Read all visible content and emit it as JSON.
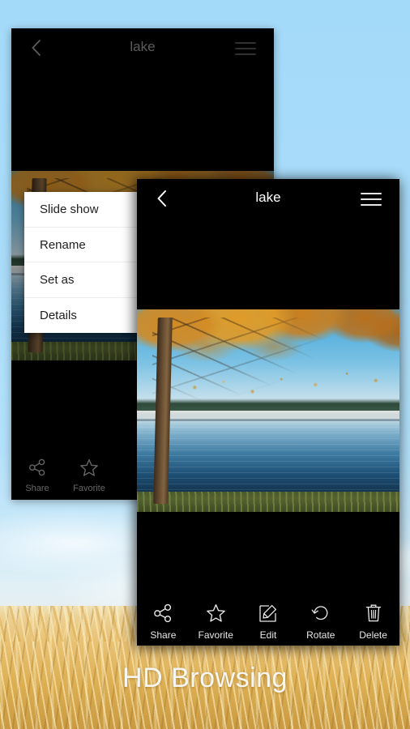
{
  "background": {
    "caption": "HD Browsing",
    "sky_color": "#a3d9f8",
    "wheat_color": "#e8c173",
    "caption_color": "#f7f6f2"
  },
  "back_window": {
    "header": {
      "title": "lake",
      "back_icon": "chevron-left-icon",
      "menu_icon": "hamburger-menu-icon"
    },
    "photo": {
      "alt": "lake",
      "subject": "autumn tree beside misty lake"
    },
    "popup_menu": {
      "items": [
        {
          "label": "Slide show"
        },
        {
          "label": "Rename"
        },
        {
          "label": "Set as"
        },
        {
          "label": "Details"
        }
      ]
    },
    "toolbar": {
      "items": [
        {
          "label": "Share",
          "icon": "share-icon"
        },
        {
          "label": "Favorite",
          "icon": "star-icon"
        }
      ]
    }
  },
  "front_window": {
    "header": {
      "title": "lake",
      "back_icon": "chevron-left-icon",
      "menu_icon": "hamburger-menu-icon"
    },
    "photo": {
      "alt": "lake",
      "subject": "autumn tree beside misty lake"
    },
    "toolbar": {
      "items": [
        {
          "label": "Share",
          "icon": "share-icon"
        },
        {
          "label": "Favorite",
          "icon": "star-icon"
        },
        {
          "label": "Edit",
          "icon": "edit-pencil-icon"
        },
        {
          "label": "Rotate",
          "icon": "rotate-left-icon"
        },
        {
          "label": "Delete",
          "icon": "trash-icon"
        }
      ]
    }
  }
}
